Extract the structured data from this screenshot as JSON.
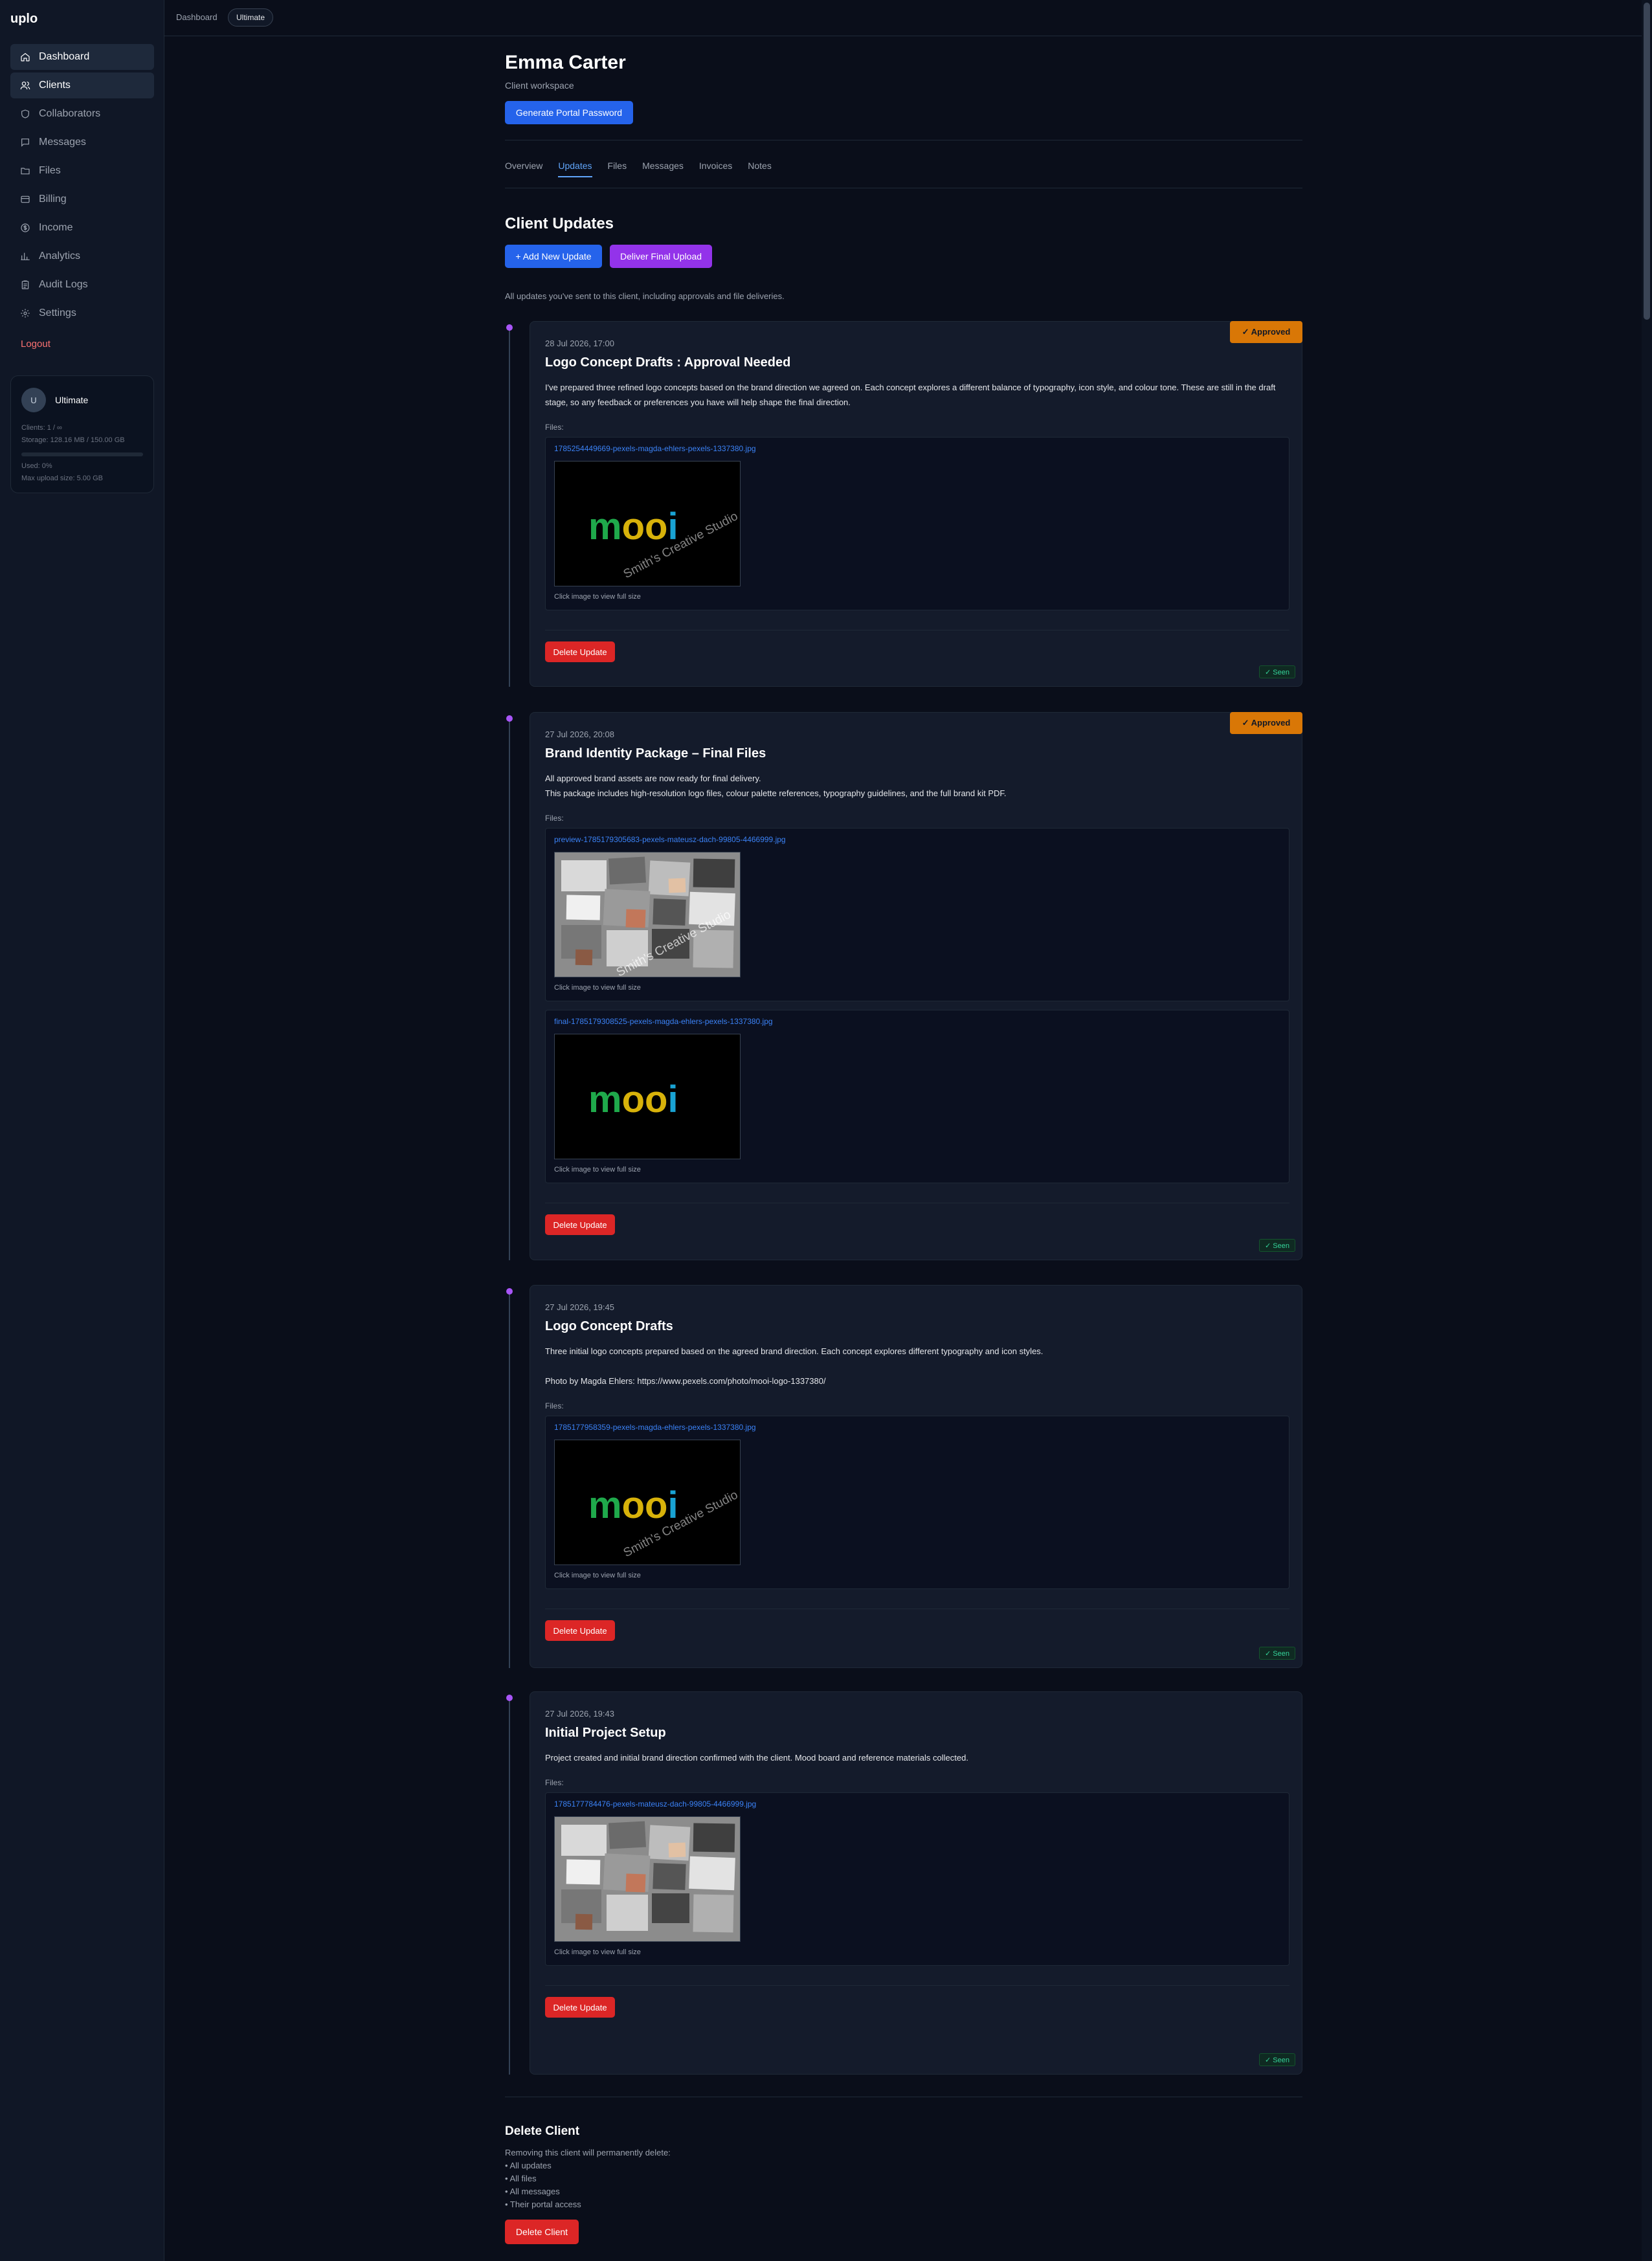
{
  "app": {
    "brand": "uplo"
  },
  "sidebar": {
    "items": [
      {
        "label": "Dashboard",
        "icon": "home-icon",
        "active": true
      },
      {
        "label": "Clients",
        "icon": "users-icon",
        "active": true
      },
      {
        "label": "Collaborators",
        "icon": "shield-icon",
        "active": false
      },
      {
        "label": "Messages",
        "icon": "message-icon",
        "active": false
      },
      {
        "label": "Files",
        "icon": "folder-icon",
        "active": false
      },
      {
        "label": "Billing",
        "icon": "credit-card-icon",
        "active": false
      },
      {
        "label": "Income",
        "icon": "dollar-circle-icon",
        "active": false
      },
      {
        "label": "Analytics",
        "icon": "bar-chart-icon",
        "active": false
      },
      {
        "label": "Audit Logs",
        "icon": "clipboard-icon",
        "active": false
      },
      {
        "label": "Settings",
        "icon": "gear-icon",
        "active": false
      }
    ],
    "logout": "Logout",
    "plan": {
      "avatar_letter": "U",
      "name": "Ultimate",
      "clients": "Clients: 1 / ∞",
      "storage": "Storage: 128.16 MB / 150.00 GB",
      "used": "Used: 0%",
      "used_fraction": 0.0,
      "max_upload": "Max upload size: 5.00 GB"
    }
  },
  "topbar": {
    "breadcrumb": "Dashboard",
    "plan_pill": "Ultimate"
  },
  "client": {
    "name": "Emma Carter",
    "subtitle": "Client workspace",
    "generate_password_label": "Generate Portal Password"
  },
  "tabs": [
    "Overview",
    "Updates",
    "Files",
    "Messages",
    "Invoices",
    "Notes"
  ],
  "active_tab": "Updates",
  "updates_section": {
    "title": "Client Updates",
    "add_label": "+ Add New Update",
    "deliver_label": "Deliver Final Upload",
    "description": "All updates you've sent to this client, including approvals and file deliveries."
  },
  "updates": [
    {
      "date": "28 Jul 2026, 17:00",
      "title": "Logo Concept Drafts : Approval Needed",
      "badge": "✓ Approved",
      "body": [
        "I've prepared three refined logo concepts based on the brand direction we agreed on. Each concept explores a different balance of typography, icon style, and colour tone. These are still in the draft stage, so any feedback or preferences you have will help shape the final direction."
      ],
      "files_label": "Files:",
      "files": [
        {
          "name": "1785254449669-pexels-magda-ehlers-pexels-1337380.jpg",
          "hint": "Click image to view full size",
          "image": "mooi-logo-watermarked"
        }
      ],
      "delete_label": "Delete Update",
      "seen": "✓ Seen"
    },
    {
      "date": "27 Jul 2026, 20:08",
      "title": "Brand Identity Package – Final Files",
      "badge": "✓ Approved",
      "body": [
        "All approved brand assets are now ready for final delivery.",
        "This package includes high-resolution logo files, colour palette references, typography guidelines, and the full brand kit PDF."
      ],
      "files_label": "Files:",
      "files": [
        {
          "name": "preview-1785179305683-pexels-mateusz-dach-99805-4466999.jpg",
          "hint": "Click image to view full size",
          "image": "mood-board-watermarked"
        },
        {
          "name": "final-1785179308525-pexels-magda-ehlers-pexels-1337380.jpg",
          "hint": "Click image to view full size",
          "image": "mooi-logo"
        }
      ],
      "delete_label": "Delete Update",
      "seen": "✓ Seen"
    },
    {
      "date": "27 Jul 2026, 19:45",
      "title": "Logo Concept Drafts",
      "badge": "",
      "body": [
        "Three initial logo concepts prepared based on the agreed brand direction. Each concept explores different typography and icon styles.",
        "",
        "Photo by Magda Ehlers: https://www.pexels.com/photo/mooi-logo-1337380/"
      ],
      "files_label": "Files:",
      "files": [
        {
          "name": "1785177958359-pexels-magda-ehlers-pexels-1337380.jpg",
          "hint": "Click image to view full size",
          "image": "mooi-logo-watermarked"
        }
      ],
      "delete_label": "Delete Update",
      "seen": "✓ Seen"
    },
    {
      "date": "27 Jul 2026, 19:43",
      "title": "Initial Project Setup",
      "badge": "",
      "body": [
        "Project created and initial brand direction confirmed with the client. Mood board and reference materials collected."
      ],
      "files_label": "Files:",
      "files": [
        {
          "name": "1785177784476-pexels-mateusz-dach-99805-4466999.jpg",
          "hint": "Click image to view full size",
          "image": "mood-board"
        }
      ],
      "delete_label": "Delete Update",
      "seen": "✓ Seen"
    }
  ],
  "watermark_text": "Smith's Creative Studio",
  "logo_word": "mooi",
  "danger": {
    "title": "Delete Client",
    "intro": "Removing this client will permanently delete:",
    "items": [
      "• All updates",
      "• All files",
      "• All messages",
      "• Their portal access"
    ],
    "button_label": "Delete Client"
  },
  "colors": {
    "accent_blue": "#2563eb",
    "accent_purple": "#9333ea",
    "danger_red": "#dc2626",
    "approved_amber": "#d97706",
    "seen_green": "#34d399",
    "link_blue": "#3b82f6",
    "timeline_dot": "#a855f7"
  }
}
